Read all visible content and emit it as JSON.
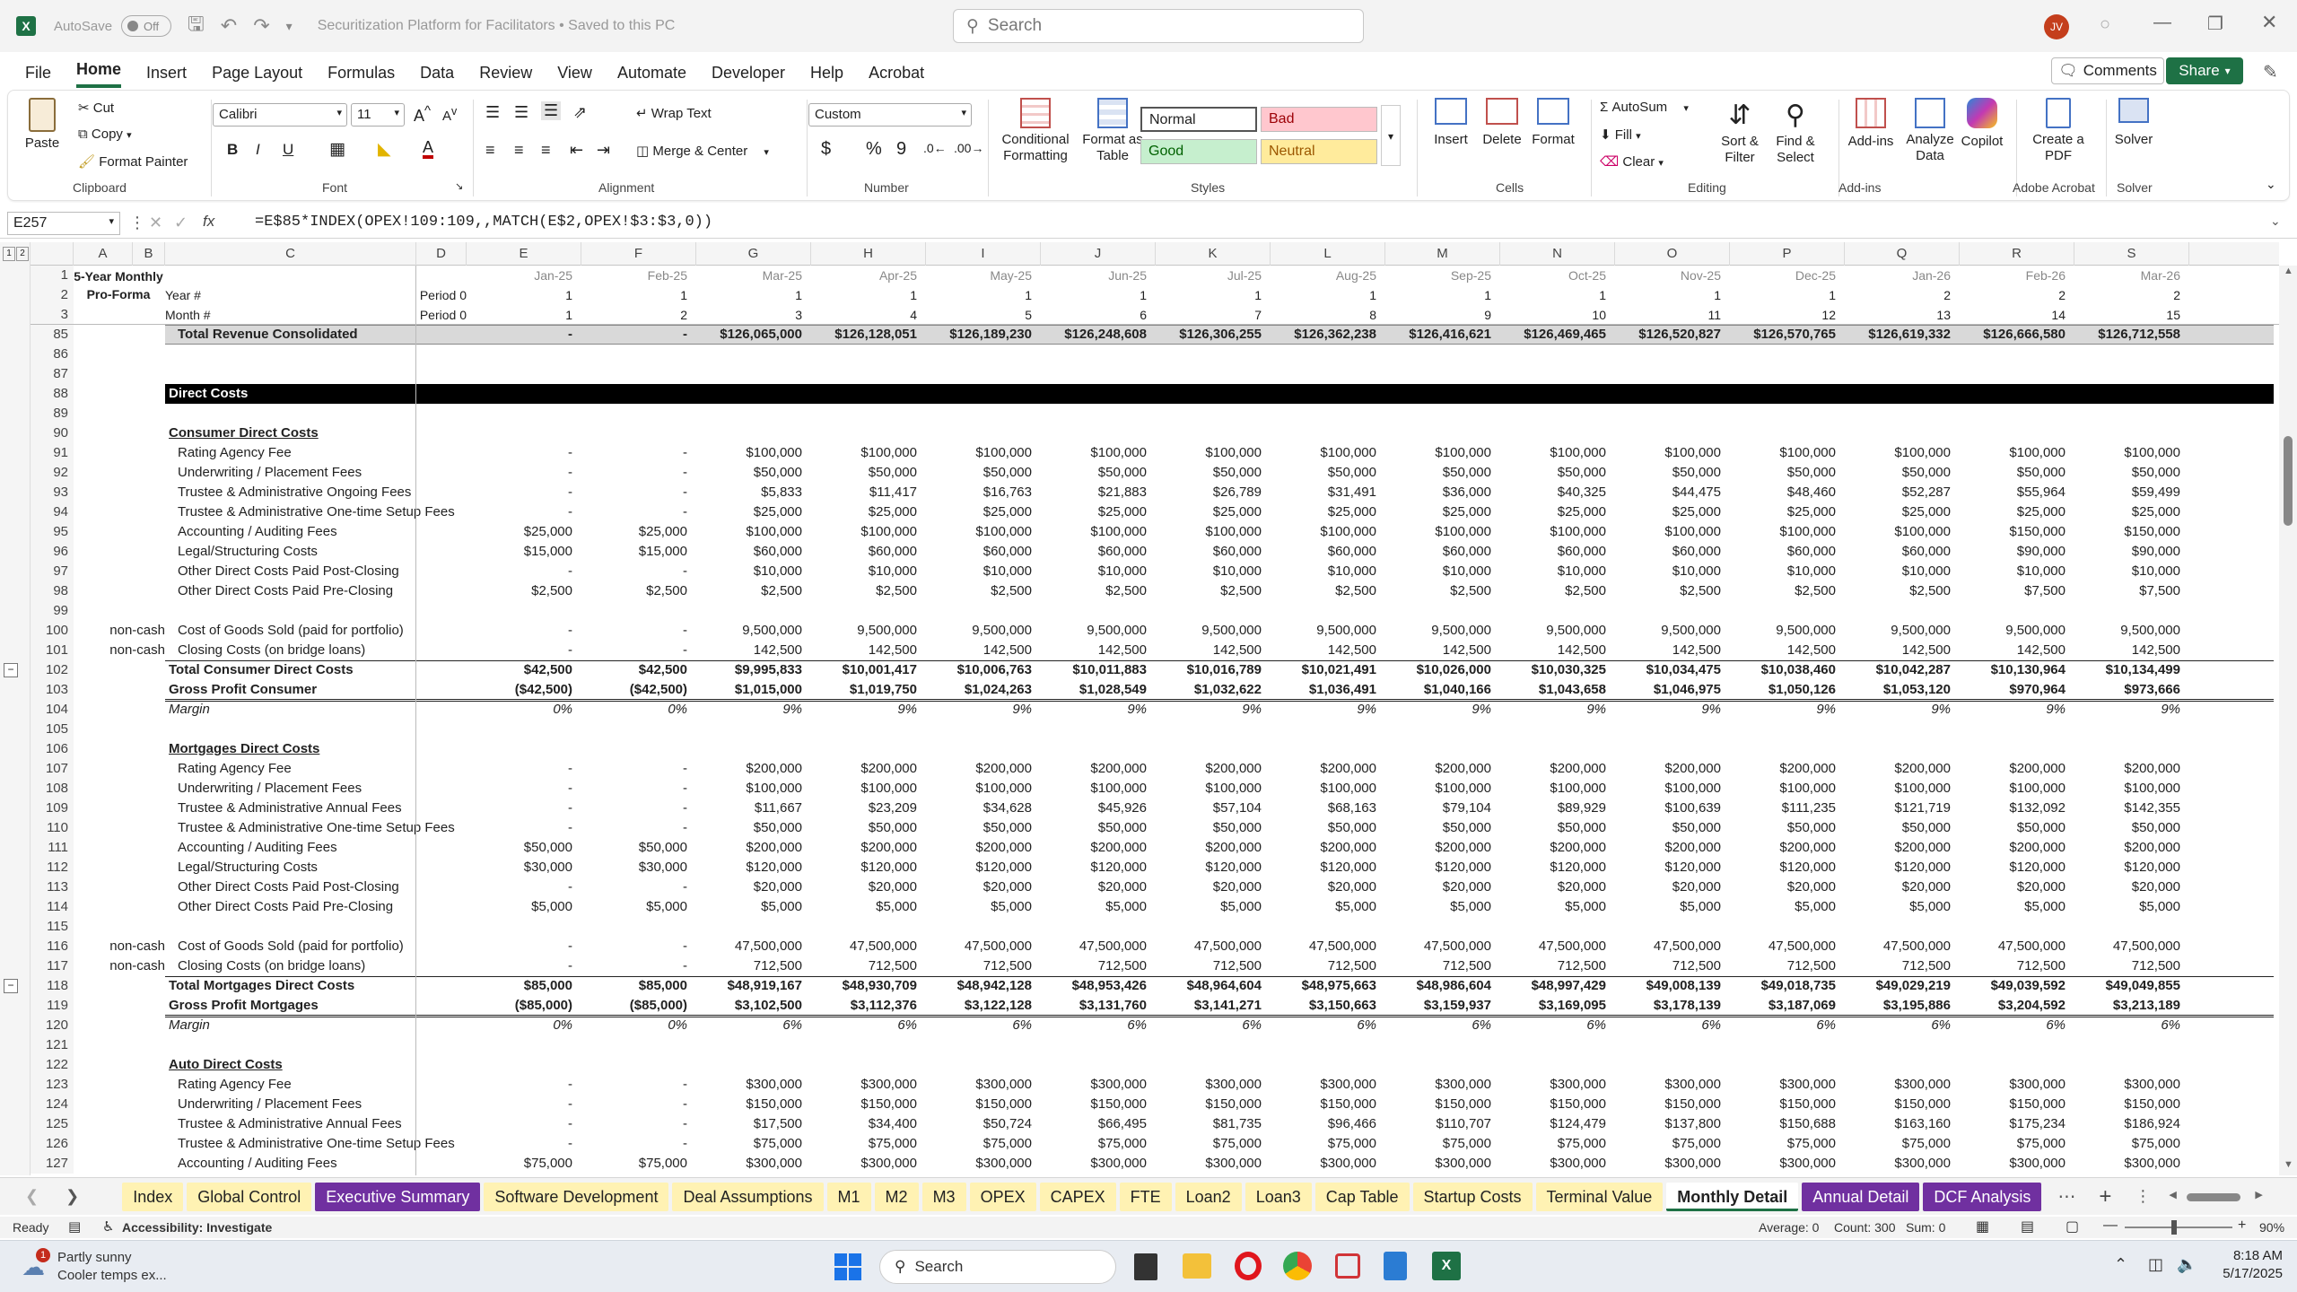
{
  "window": {
    "autosave_label": "AutoSave",
    "autosave_state": "Off",
    "title": "Securitization Platform for Facilitators • Saved to this PC",
    "search_placeholder": "Search",
    "user_initials": "JV",
    "brand_color": "#1e7145"
  },
  "menu": [
    "File",
    "Home",
    "Insert",
    "Page Layout",
    "Formulas",
    "Data",
    "Review",
    "View",
    "Automate",
    "Developer",
    "Help",
    "Acrobat"
  ],
  "menu_active": "Home",
  "comments_label": "Comments",
  "share_label": "Share",
  "ribbon": {
    "clipboard": {
      "paste": "Paste",
      "cut": "Cut",
      "copy": "Copy",
      "format_painter": "Format Painter",
      "label": "Clipboard"
    },
    "font": {
      "name": "Calibri",
      "size": "11",
      "label": "Font"
    },
    "alignment": {
      "wrap": "Wrap Text",
      "merge": "Merge & Center",
      "label": "Alignment"
    },
    "number": {
      "format": "Custom",
      "label": "Number"
    },
    "styles": {
      "cond": "Conditional Formatting",
      "table": "Format as Table",
      "normal": "Normal",
      "bad": "Bad",
      "good": "Good",
      "neutral": "Neutral",
      "label": "Styles"
    },
    "cells": {
      "insert": "Insert",
      "delete": "Delete",
      "format": "Format",
      "label": "Cells"
    },
    "editing": {
      "autosum": "AutoSum",
      "fill": "Fill",
      "clear": "Clear",
      "sort": "Sort & Filter",
      "find": "Find & Select",
      "label": "Editing"
    },
    "addins": {
      "addins": "Add-ins",
      "analyze": "Analyze Data",
      "copilot": "Copilot",
      "label": "Add-ins"
    },
    "acrobat": {
      "create": "Create a PDF",
      "label": "Adobe Acrobat"
    },
    "solver": {
      "solver": "Solver",
      "label": "Solver"
    }
  },
  "formula_bar": {
    "name_box": "E257",
    "fx": "fx",
    "formula": "=E$85*INDEX(OPEX!109:109,,MATCH(E$2,OPEX!$3:$3,0))"
  },
  "columns": [
    "A",
    "B",
    "C",
    "D",
    "E",
    "F",
    "G",
    "H",
    "I",
    "J",
    "K",
    "L",
    "M",
    "N",
    "O",
    "P",
    "Q",
    "R",
    "S"
  ],
  "outline_levels": [
    "1",
    "2"
  ],
  "header_rows": {
    "r1": {
      "a": "5-Year Monthly Pro-Forma",
      "dates": [
        "Jan-25",
        "Feb-25",
        "Mar-25",
        "Apr-25",
        "May-25",
        "Jun-25",
        "Jul-25",
        "Aug-25",
        "Sep-25",
        "Oct-25",
        "Nov-25",
        "Dec-25",
        "Jan-26",
        "Feb-26",
        "Mar-26"
      ]
    },
    "r2": {
      "c": "Year #",
      "d": "Period 0",
      "vals": [
        "1",
        "1",
        "1",
        "1",
        "1",
        "1",
        "1",
        "1",
        "1",
        "1",
        "1",
        "1",
        "2",
        "2",
        "2"
      ]
    },
    "r3": {
      "c": "Month #",
      "d": "Period 0",
      "vals": [
        "1",
        "2",
        "3",
        "4",
        "5",
        "6",
        "7",
        "8",
        "9",
        "10",
        "11",
        "12",
        "13",
        "14",
        "15"
      ]
    }
  },
  "rows": [
    {
      "n": "85",
      "style": "total-rev",
      "c": "Total Revenue Consolidated",
      "v": [
        "-",
        "-",
        "$126,065,000",
        "$126,128,051",
        "$126,189,230",
        "$126,248,608",
        "$126,306,255",
        "$126,362,238",
        "$126,416,621",
        "$126,469,465",
        "$126,520,827",
        "$126,570,765",
        "$126,619,332",
        "$126,666,580",
        "$126,712,558"
      ]
    },
    {
      "n": "86",
      "v": []
    },
    {
      "n": "87",
      "v": []
    },
    {
      "n": "88",
      "style": "black",
      "c": "Direct Costs",
      "v": []
    },
    {
      "n": "89",
      "v": []
    },
    {
      "n": "90",
      "style": "section",
      "c": "Consumer Direct Costs",
      "v": []
    },
    {
      "n": "91",
      "c": "Rating Agency Fee",
      "indent": 1,
      "v": [
        "-",
        "-",
        "$100,000",
        "$100,000",
        "$100,000",
        "$100,000",
        "$100,000",
        "$100,000",
        "$100,000",
        "$100,000",
        "$100,000",
        "$100,000",
        "$100,000",
        "$100,000",
        "$100,000"
      ]
    },
    {
      "n": "92",
      "c": "Underwriting / Placement Fees",
      "indent": 1,
      "v": [
        "-",
        "-",
        "$50,000",
        "$50,000",
        "$50,000",
        "$50,000",
        "$50,000",
        "$50,000",
        "$50,000",
        "$50,000",
        "$50,000",
        "$50,000",
        "$50,000",
        "$50,000",
        "$50,000"
      ]
    },
    {
      "n": "93",
      "c": "Trustee & Administrative Ongoing Fees",
      "indent": 1,
      "v": [
        "-",
        "-",
        "$5,833",
        "$11,417",
        "$16,763",
        "$21,883",
        "$26,789",
        "$31,491",
        "$36,000",
        "$40,325",
        "$44,475",
        "$48,460",
        "$52,287",
        "$55,964",
        "$59,499"
      ]
    },
    {
      "n": "94",
      "c": "Trustee & Administrative One-time Setup Fees",
      "indent": 1,
      "v": [
        "-",
        "-",
        "$25,000",
        "$25,000",
        "$25,000",
        "$25,000",
        "$25,000",
        "$25,000",
        "$25,000",
        "$25,000",
        "$25,000",
        "$25,000",
        "$25,000",
        "$25,000",
        "$25,000"
      ]
    },
    {
      "n": "95",
      "c": "Accounting / Auditing Fees",
      "indent": 1,
      "v": [
        "$25,000",
        "$25,000",
        "$100,000",
        "$100,000",
        "$100,000",
        "$100,000",
        "$100,000",
        "$100,000",
        "$100,000",
        "$100,000",
        "$100,000",
        "$100,000",
        "$100,000",
        "$150,000",
        "$150,000"
      ]
    },
    {
      "n": "96",
      "c": "Legal/Structuring Costs",
      "indent": 1,
      "v": [
        "$15,000",
        "$15,000",
        "$60,000",
        "$60,000",
        "$60,000",
        "$60,000",
        "$60,000",
        "$60,000",
        "$60,000",
        "$60,000",
        "$60,000",
        "$60,000",
        "$60,000",
        "$90,000",
        "$90,000"
      ]
    },
    {
      "n": "97",
      "c": "Other Direct Costs Paid Post-Closing",
      "indent": 1,
      "v": [
        "-",
        "-",
        "$10,000",
        "$10,000",
        "$10,000",
        "$10,000",
        "$10,000",
        "$10,000",
        "$10,000",
        "$10,000",
        "$10,000",
        "$10,000",
        "$10,000",
        "$10,000",
        "$10,000"
      ]
    },
    {
      "n": "98",
      "c": "Other Direct Costs Paid Pre-Closing",
      "indent": 1,
      "v": [
        "$2,500",
        "$2,500",
        "$2,500",
        "$2,500",
        "$2,500",
        "$2,500",
        "$2,500",
        "$2,500",
        "$2,500",
        "$2,500",
        "$2,500",
        "$2,500",
        "$2,500",
        "$7,500",
        "$7,500"
      ]
    },
    {
      "n": "99",
      "v": []
    },
    {
      "n": "100",
      "b": "non-cash",
      "c": "Cost of Goods Sold (paid for portfolio)",
      "indent": 1,
      "v": [
        "-",
        "-",
        "9,500,000",
        "9,500,000",
        "9,500,000",
        "9,500,000",
        "9,500,000",
        "9,500,000",
        "9,500,000",
        "9,500,000",
        "9,500,000",
        "9,500,000",
        "9,500,000",
        "9,500,000",
        "9,500,000"
      ]
    },
    {
      "n": "101",
      "b": "non-cash",
      "c": "Closing Costs (on bridge loans)",
      "indent": 1,
      "v": [
        "-",
        "-",
        "142,500",
        "142,500",
        "142,500",
        "142,500",
        "142,500",
        "142,500",
        "142,500",
        "142,500",
        "142,500",
        "142,500",
        "142,500",
        "142,500",
        "142,500"
      ]
    },
    {
      "n": "102",
      "style": "total",
      "c": "Total Consumer Direct Costs",
      "v": [
        "$42,500",
        "$42,500",
        "$9,995,833",
        "$10,001,417",
        "$10,006,763",
        "$10,011,883",
        "$10,016,789",
        "$10,021,491",
        "$10,026,000",
        "$10,030,325",
        "$10,034,475",
        "$10,038,460",
        "$10,042,287",
        "$10,130,964",
        "$10,134,499"
      ]
    },
    {
      "n": "103",
      "style": "gross",
      "c": "Gross Profit Consumer",
      "v": [
        "($42,500)",
        "($42,500)",
        "$1,015,000",
        "$1,019,750",
        "$1,024,263",
        "$1,028,549",
        "$1,032,622",
        "$1,036,491",
        "$1,040,166",
        "$1,043,658",
        "$1,046,975",
        "$1,050,126",
        "$1,053,120",
        "$970,964",
        "$973,666"
      ]
    },
    {
      "n": "104",
      "style": "margin",
      "c": "Margin",
      "v": [
        "0%",
        "0%",
        "9%",
        "9%",
        "9%",
        "9%",
        "9%",
        "9%",
        "9%",
        "9%",
        "9%",
        "9%",
        "9%",
        "9%",
        "9%"
      ]
    },
    {
      "n": "105",
      "v": []
    },
    {
      "n": "106",
      "style": "section",
      "c": "Mortgages Direct Costs",
      "v": []
    },
    {
      "n": "107",
      "c": "Rating Agency Fee",
      "indent": 1,
      "v": [
        "-",
        "-",
        "$200,000",
        "$200,000",
        "$200,000",
        "$200,000",
        "$200,000",
        "$200,000",
        "$200,000",
        "$200,000",
        "$200,000",
        "$200,000",
        "$200,000",
        "$200,000",
        "$200,000"
      ]
    },
    {
      "n": "108",
      "c": "Underwriting / Placement Fees",
      "indent": 1,
      "v": [
        "-",
        "-",
        "$100,000",
        "$100,000",
        "$100,000",
        "$100,000",
        "$100,000",
        "$100,000",
        "$100,000",
        "$100,000",
        "$100,000",
        "$100,000",
        "$100,000",
        "$100,000",
        "$100,000"
      ]
    },
    {
      "n": "109",
      "c": "Trustee & Administrative Annual Fees",
      "indent": 1,
      "v": [
        "-",
        "-",
        "$11,667",
        "$23,209",
        "$34,628",
        "$45,926",
        "$57,104",
        "$68,163",
        "$79,104",
        "$89,929",
        "$100,639",
        "$111,235",
        "$121,719",
        "$132,092",
        "$142,355"
      ]
    },
    {
      "n": "110",
      "c": "Trustee & Administrative One-time Setup Fees",
      "indent": 1,
      "v": [
        "-",
        "-",
        "$50,000",
        "$50,000",
        "$50,000",
        "$50,000",
        "$50,000",
        "$50,000",
        "$50,000",
        "$50,000",
        "$50,000",
        "$50,000",
        "$50,000",
        "$50,000",
        "$50,000"
      ]
    },
    {
      "n": "111",
      "c": "Accounting / Auditing Fees",
      "indent": 1,
      "v": [
        "$50,000",
        "$50,000",
        "$200,000",
        "$200,000",
        "$200,000",
        "$200,000",
        "$200,000",
        "$200,000",
        "$200,000",
        "$200,000",
        "$200,000",
        "$200,000",
        "$200,000",
        "$200,000",
        "$200,000"
      ]
    },
    {
      "n": "112",
      "c": "Legal/Structuring Costs",
      "indent": 1,
      "v": [
        "$30,000",
        "$30,000",
        "$120,000",
        "$120,000",
        "$120,000",
        "$120,000",
        "$120,000",
        "$120,000",
        "$120,000",
        "$120,000",
        "$120,000",
        "$120,000",
        "$120,000",
        "$120,000",
        "$120,000"
      ]
    },
    {
      "n": "113",
      "c": "Other Direct Costs Paid Post-Closing",
      "indent": 1,
      "v": [
        "-",
        "-",
        "$20,000",
        "$20,000",
        "$20,000",
        "$20,000",
        "$20,000",
        "$20,000",
        "$20,000",
        "$20,000",
        "$20,000",
        "$20,000",
        "$20,000",
        "$20,000",
        "$20,000"
      ]
    },
    {
      "n": "114",
      "c": "Other Direct Costs Paid Pre-Closing",
      "indent": 1,
      "v": [
        "$5,000",
        "$5,000",
        "$5,000",
        "$5,000",
        "$5,000",
        "$5,000",
        "$5,000",
        "$5,000",
        "$5,000",
        "$5,000",
        "$5,000",
        "$5,000",
        "$5,000",
        "$5,000",
        "$5,000"
      ]
    },
    {
      "n": "115",
      "v": []
    },
    {
      "n": "116",
      "b": "non-cash",
      "c": "Cost of Goods Sold (paid for portfolio)",
      "indent": 1,
      "v": [
        "-",
        "-",
        "47,500,000",
        "47,500,000",
        "47,500,000",
        "47,500,000",
        "47,500,000",
        "47,500,000",
        "47,500,000",
        "47,500,000",
        "47,500,000",
        "47,500,000",
        "47,500,000",
        "47,500,000",
        "47,500,000"
      ]
    },
    {
      "n": "117",
      "b": "non-cash",
      "c": "Closing Costs (on bridge loans)",
      "indent": 1,
      "v": [
        "-",
        "-",
        "712,500",
        "712,500",
        "712,500",
        "712,500",
        "712,500",
        "712,500",
        "712,500",
        "712,500",
        "712,500",
        "712,500",
        "712,500",
        "712,500",
        "712,500"
      ]
    },
    {
      "n": "118",
      "style": "total",
      "c": "Total Mortgages Direct Costs",
      "v": [
        "$85,000",
        "$85,000",
        "$48,919,167",
        "$48,930,709",
        "$48,942,128",
        "$48,953,426",
        "$48,964,604",
        "$48,975,663",
        "$48,986,604",
        "$48,997,429",
        "$49,008,139",
        "$49,018,735",
        "$49,029,219",
        "$49,039,592",
        "$49,049,855"
      ]
    },
    {
      "n": "119",
      "style": "gross",
      "c": "Gross Profit Mortgages",
      "v": [
        "($85,000)",
        "($85,000)",
        "$3,102,500",
        "$3,112,376",
        "$3,122,128",
        "$3,131,760",
        "$3,141,271",
        "$3,150,663",
        "$3,159,937",
        "$3,169,095",
        "$3,178,139",
        "$3,187,069",
        "$3,195,886",
        "$3,204,592",
        "$3,213,189"
      ]
    },
    {
      "n": "120",
      "style": "margin",
      "c": "Margin",
      "v": [
        "0%",
        "0%",
        "6%",
        "6%",
        "6%",
        "6%",
        "6%",
        "6%",
        "6%",
        "6%",
        "6%",
        "6%",
        "6%",
        "6%",
        "6%"
      ]
    },
    {
      "n": "121",
      "v": []
    },
    {
      "n": "122",
      "style": "section",
      "c": "Auto Direct Costs",
      "v": []
    },
    {
      "n": "123",
      "c": "Rating Agency Fee",
      "indent": 1,
      "v": [
        "-",
        "-",
        "$300,000",
        "$300,000",
        "$300,000",
        "$300,000",
        "$300,000",
        "$300,000",
        "$300,000",
        "$300,000",
        "$300,000",
        "$300,000",
        "$300,000",
        "$300,000",
        "$300,000"
      ]
    },
    {
      "n": "124",
      "c": "Underwriting / Placement Fees",
      "indent": 1,
      "v": [
        "-",
        "-",
        "$150,000",
        "$150,000",
        "$150,000",
        "$150,000",
        "$150,000",
        "$150,000",
        "$150,000",
        "$150,000",
        "$150,000",
        "$150,000",
        "$150,000",
        "$150,000",
        "$150,000"
      ]
    },
    {
      "n": "125",
      "c": "Trustee & Administrative Annual Fees",
      "indent": 1,
      "v": [
        "-",
        "-",
        "$17,500",
        "$34,400",
        "$50,724",
        "$66,495",
        "$81,735",
        "$96,466",
        "$110,707",
        "$124,479",
        "$137,800",
        "$150,688",
        "$163,160",
        "$175,234",
        "$186,924"
      ]
    },
    {
      "n": "126",
      "c": "Trustee & Administrative One-time Setup Fees",
      "indent": 1,
      "v": [
        "-",
        "-",
        "$75,000",
        "$75,000",
        "$75,000",
        "$75,000",
        "$75,000",
        "$75,000",
        "$75,000",
        "$75,000",
        "$75,000",
        "$75,000",
        "$75,000",
        "$75,000",
        "$75,000"
      ]
    },
    {
      "n": "127",
      "c": "Accounting / Auditing Fees",
      "indent": 1,
      "v": [
        "$75,000",
        "$75,000",
        "$300,000",
        "$300,000",
        "$300,000",
        "$300,000",
        "$300,000",
        "$300,000",
        "$300,000",
        "$300,000",
        "$300,000",
        "$300,000",
        "$300,000",
        "$300,000",
        "$300,000"
      ]
    }
  ],
  "tabs": [
    {
      "label": "Index",
      "color": "#fff2b3"
    },
    {
      "label": "Global Control",
      "color": "#fff2b3"
    },
    {
      "label": "Executive Summary",
      "color": "#7030a0",
      "text": "#ffffff"
    },
    {
      "label": "Software Development",
      "color": "#fff2b3"
    },
    {
      "label": "Deal Assumptions",
      "color": "#fff2b3"
    },
    {
      "label": "M1",
      "color": "#fff2b3"
    },
    {
      "label": "M2",
      "color": "#fff2b3"
    },
    {
      "label": "M3",
      "color": "#fff2b3"
    },
    {
      "label": "OPEX",
      "color": "#fff2b3"
    },
    {
      "label": "CAPEX",
      "color": "#fff2b3"
    },
    {
      "label": "FTE",
      "color": "#fff2b3"
    },
    {
      "label": "Loan2",
      "color": "#fff2b3"
    },
    {
      "label": "Loan3",
      "color": "#fff2b3"
    },
    {
      "label": "Cap Table",
      "color": "#fff2b3"
    },
    {
      "label": "Startup Costs",
      "color": "#fff2b3"
    },
    {
      "label": "Terminal Value",
      "color": "#fff2b3"
    },
    {
      "label": "Monthly Detail",
      "color": "#e6e6e6",
      "active": true
    },
    {
      "label": "Annual Detail",
      "color": "#7030a0",
      "text": "#ffffff"
    },
    {
      "label": "DCF Analysis",
      "color": "#7030a0",
      "text": "#ffffff"
    }
  ],
  "status": {
    "ready": "Ready",
    "accessibility": "Accessibility: Investigate",
    "average": "Average: 0",
    "count": "Count: 300",
    "sum": "Sum: 0",
    "zoom": "90%"
  },
  "taskbar": {
    "weather_title": "Partly sunny",
    "weather_sub": "Cooler temps ex...",
    "search": "Search",
    "time": "8:18 AM",
    "date": "5/17/2025",
    "badge": "1"
  }
}
